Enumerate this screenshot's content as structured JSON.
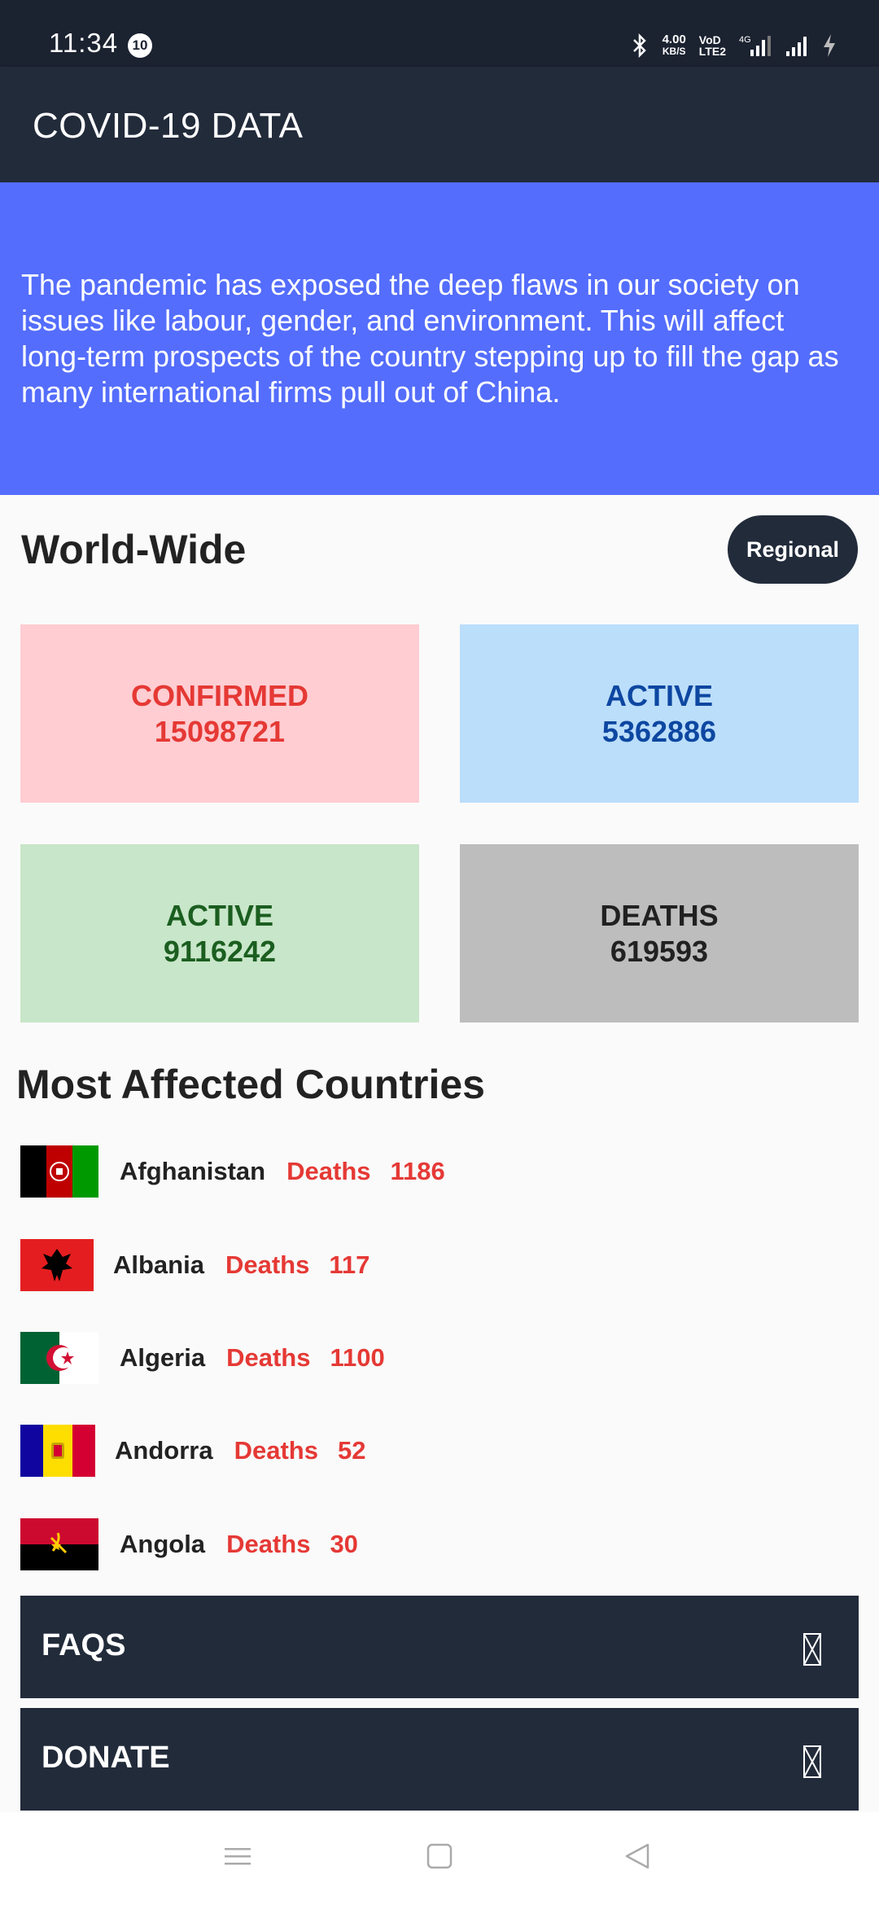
{
  "status_bar": {
    "time": "11:34",
    "notification_count": "10",
    "speed_value": "4.00",
    "speed_unit": "KB/S",
    "volte_line1": "VoD",
    "volte_line2": "LTE2",
    "network_type": "4G",
    "icons": [
      "bluetooth-icon",
      "signal-icon",
      "signal-icon",
      "charging-icon"
    ]
  },
  "app_bar": {
    "title": "COVID-19 DATA"
  },
  "banner": {
    "text": "The pandemic has exposed the deep flaws in our society on issues like labour, gender, and environment. This will affect long-term prospects of the country stepping up to fill the gap as many international firms pull out of China."
  },
  "world_wide": {
    "title": "World-Wide",
    "regional_button": "Regional",
    "stats": [
      {
        "label": "CONFIRMED",
        "value": "15098721",
        "color": "#e53935"
      },
      {
        "label": "ACTIVE",
        "value": "5362886",
        "color": "#0d47a1"
      },
      {
        "label": "ACTIVE",
        "value": "9116242",
        "color": "#1b5e20"
      },
      {
        "label": "DEATHS",
        "value": "619593",
        "color": "#212121"
      }
    ]
  },
  "most_affected": {
    "title": "Most Affected Countries",
    "deaths_label": "Deaths",
    "countries": [
      {
        "name": "Afghanistan",
        "deaths": "1186"
      },
      {
        "name": "Albania",
        "deaths": "117"
      },
      {
        "name": "Algeria",
        "deaths": "1100"
      },
      {
        "name": "Andorra",
        "deaths": "52"
      },
      {
        "name": "Angola",
        "deaths": "30"
      }
    ]
  },
  "sections": {
    "faqs": "FAQS",
    "donate": "DONATE"
  },
  "nav_bar": {
    "icons": [
      "menu-icon",
      "home-icon",
      "back-icon"
    ]
  }
}
